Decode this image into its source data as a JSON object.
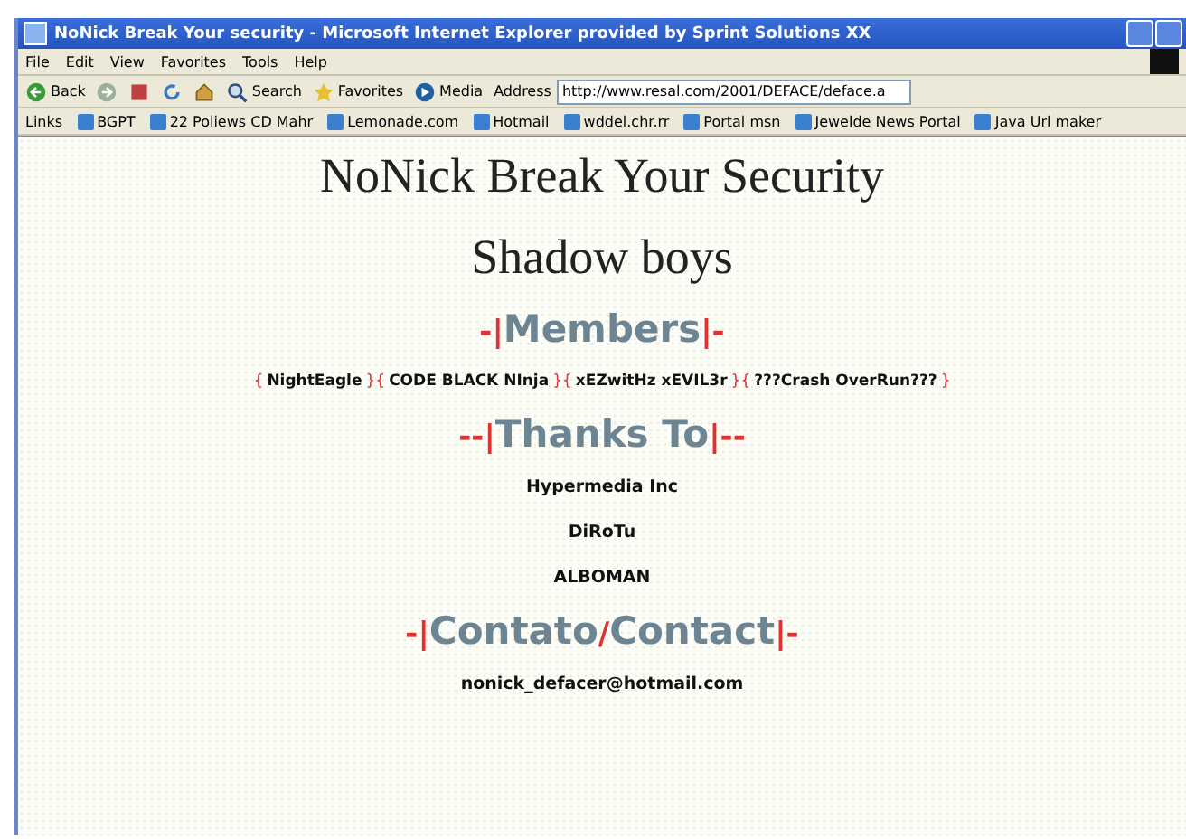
{
  "window": {
    "title": "NoNick Break Your security - Microsoft Internet Explorer provided by Sprint Solutions XX"
  },
  "menu_bar": [
    "File",
    "Edit",
    "View",
    "Favorites",
    "Tools",
    "Help"
  ],
  "toolbar": [
    {
      "label": "Back",
      "kind": "back"
    },
    {
      "kind": "forward"
    },
    {
      "kind": "stop"
    },
    {
      "kind": "refresh"
    },
    {
      "kind": "home"
    },
    {
      "label": "Search",
      "kind": "search"
    },
    {
      "label": "Favorites",
      "kind": "favorites"
    },
    {
      "label": "Media",
      "kind": "media"
    }
  ],
  "address": {
    "label": "Address",
    "value": "http://www.resal.com/2001/DEFACE/deface.a"
  },
  "links_bar": {
    "label": "Links",
    "items": [
      "BGPT",
      "22 Poliews CD Mahr",
      "Lemonade.com",
      "Hotmail",
      "wddel.chr.rr",
      "Portal msn",
      "Jewelde News Portal",
      "Java Url maker"
    ]
  },
  "page": {
    "title": "NoNick Break Your Security",
    "subtitle": "Shadow boys",
    "sections": [
      {
        "heading": [
          {
            "text": "-|",
            "kind": "accent"
          },
          {
            "text": "Members",
            "kind": "main"
          },
          {
            "text": "|-",
            "kind": "accent"
          }
        ],
        "kind": "inline",
        "items": [
          {
            "text": "{",
            "kind": "accent"
          },
          {
            "text": "NightEagle",
            "kind": "name"
          },
          {
            "text": "}{",
            "kind": "accent"
          },
          {
            "text": "CODE BLACK NInja",
            "kind": "name"
          },
          {
            "text": "}{",
            "kind": "accent"
          },
          {
            "text": "xEZwitHz xEVIL3r",
            "kind": "name"
          },
          {
            "text": "}{",
            "kind": "accent"
          },
          {
            "text": "???Crash OverRun???",
            "kind": "name"
          },
          {
            "text": "}",
            "kind": "accent"
          }
        ]
      },
      {
        "heading": [
          {
            "text": "--|",
            "kind": "accent"
          },
          {
            "text": "Thanks To",
            "kind": "main"
          },
          {
            "text": "|--",
            "kind": "accent"
          }
        ],
        "kind": "stack",
        "items": [
          "Hypermedia Inc",
          "DiRoTu",
          "ALBOMAN"
        ]
      },
      {
        "heading": [
          {
            "text": "-|",
            "kind": "accent"
          },
          {
            "text": "Contato",
            "kind": "main"
          },
          {
            "text": "/",
            "kind": "accent"
          },
          {
            "text": "Contact",
            "kind": "main"
          },
          {
            "text": "|-",
            "kind": "accent"
          }
        ],
        "kind": "stack",
        "items": [
          "nonick_defacer@hotmail.com"
        ]
      }
    ]
  }
}
